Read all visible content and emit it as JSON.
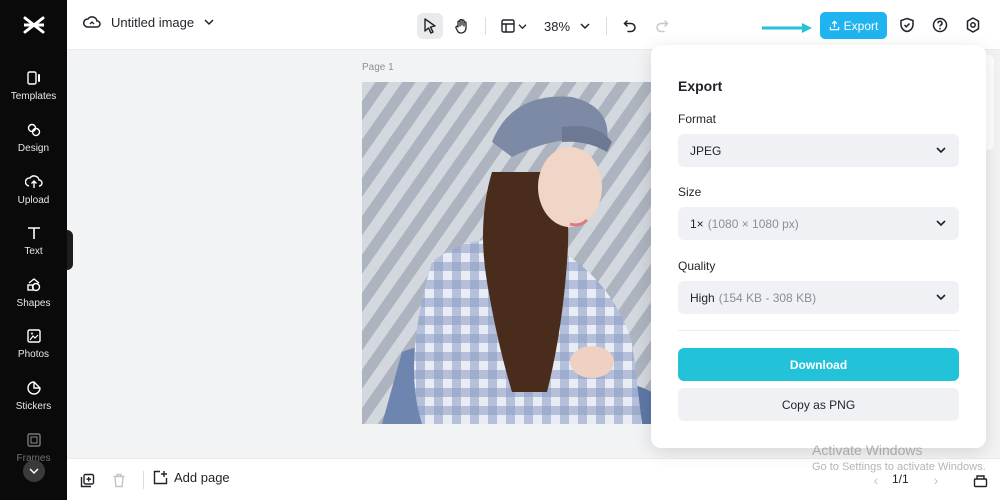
{
  "sidebar": {
    "items": [
      {
        "label": "Templates",
        "icon": "templates-icon"
      },
      {
        "label": "Design",
        "icon": "design-icon"
      },
      {
        "label": "Upload",
        "icon": "upload-icon"
      },
      {
        "label": "Text",
        "icon": "text-icon"
      },
      {
        "label": "Shapes",
        "icon": "shapes-icon"
      },
      {
        "label": "Photos",
        "icon": "photos-icon"
      },
      {
        "label": "Stickers",
        "icon": "stickers-icon"
      },
      {
        "label": "Frames",
        "icon": "frames-icon"
      }
    ]
  },
  "header": {
    "file_title": "Untitled image",
    "zoom": "38%",
    "export_label": "Export"
  },
  "canvas": {
    "page_label": "Page 1"
  },
  "export_panel": {
    "title": "Export",
    "format_label": "Format",
    "format_value": "JPEG",
    "size_label": "Size",
    "size_value": "1×",
    "size_hint": "(1080 × 1080 px)",
    "quality_label": "Quality",
    "quality_value": "High",
    "quality_hint": "(154 KB - 308 KB)",
    "download_label": "Download",
    "copy_label": "Copy as PNG"
  },
  "bottombar": {
    "add_page_label": "Add page",
    "pager": "1/1"
  },
  "watermark": {
    "line1": "Activate Windows",
    "line2": "Go to Settings to activate Windows."
  },
  "colors": {
    "accent": "#1fb4f0",
    "download": "#22c2d9",
    "sidebar": "#0a0a0a"
  }
}
